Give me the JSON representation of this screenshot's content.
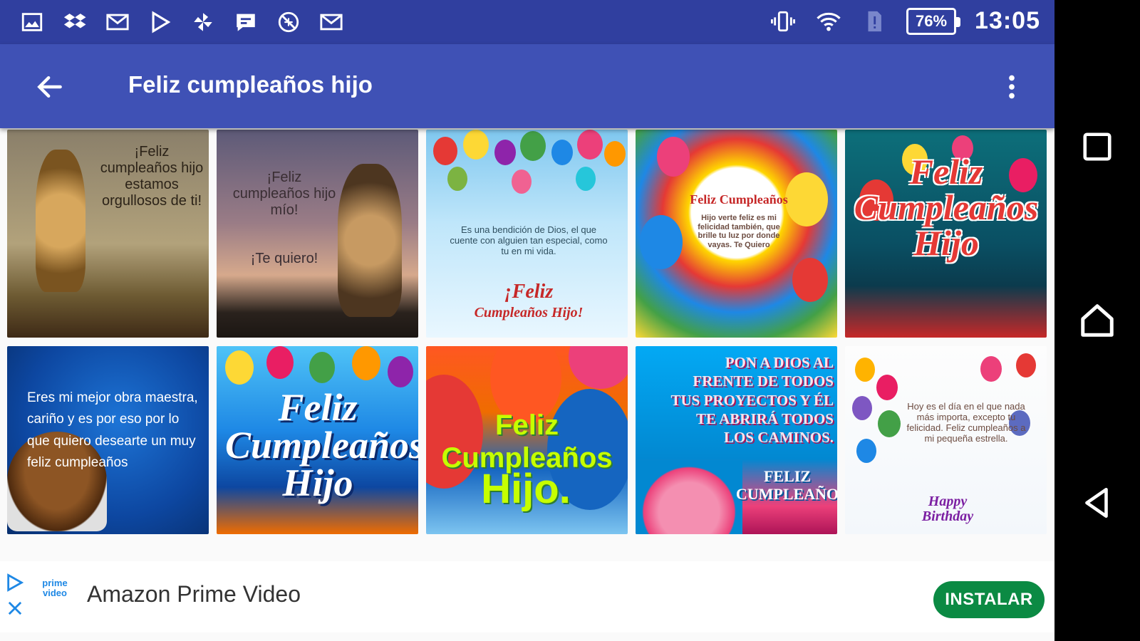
{
  "status_bar": {
    "left_icons": [
      "gallery-icon",
      "dropbox-icon",
      "gmail-icon",
      "play-store-icon",
      "pinwheel-icon",
      "chat-icon",
      "no-data-icon",
      "mail-icon"
    ],
    "battery": "76%",
    "time": "13:05"
  },
  "appbar": {
    "title": "Feliz cumpleaños hijo"
  },
  "tiles": [
    {
      "text": "¡Feliz cumpleaños hijo estamos orgullosos de ti!"
    },
    {
      "text": "¡Feliz cumpleaños hijo mío!",
      "text2": "¡Te quiero!"
    },
    {
      "text": "Es una bendición de Dios, el que cuente con alguien tan especial, como tu en mi vida.",
      "text2": "¡Feliz",
      "text3": "Cumpleaños Hijo!"
    },
    {
      "text": "Feliz Cumpleaños",
      "text2": "Hijo verte feliz es mi felicidad también, que brille tu luz por donde vayas. Te Quiero"
    },
    {
      "text": "Feliz Cumpleaños Hijo"
    },
    {
      "text": "Eres mi mejor obra maestra, cariño y es por eso por lo que quiero desearte un muy feliz cumpleaños"
    },
    {
      "text": "Feliz Cumpleaños Hijo"
    },
    {
      "text": "Feliz Cumpleaños",
      "text2": "Hijo."
    },
    {
      "text": "PON A DIOS AL FRENTE DE TODOS TUS PROYECTOS Y ÉL TE ABRIRÁ TODOS LOS CAMINOS.",
      "text2": "FELIZ CUMPLEAÑO"
    },
    {
      "text": "Hoy es el día en el que nada más importa, excepto tu felicidad. Feliz cumpleaños a mi pequeña estrella.",
      "text2": "Happy Birthday"
    }
  ],
  "ad": {
    "logo": "prime video",
    "title": "Amazon Prime Video",
    "button": "INSTALAR"
  },
  "colors": {
    "status_bar": "#303f9f",
    "app_bar": "#3f51b5",
    "install_button": "#0b8a43"
  }
}
